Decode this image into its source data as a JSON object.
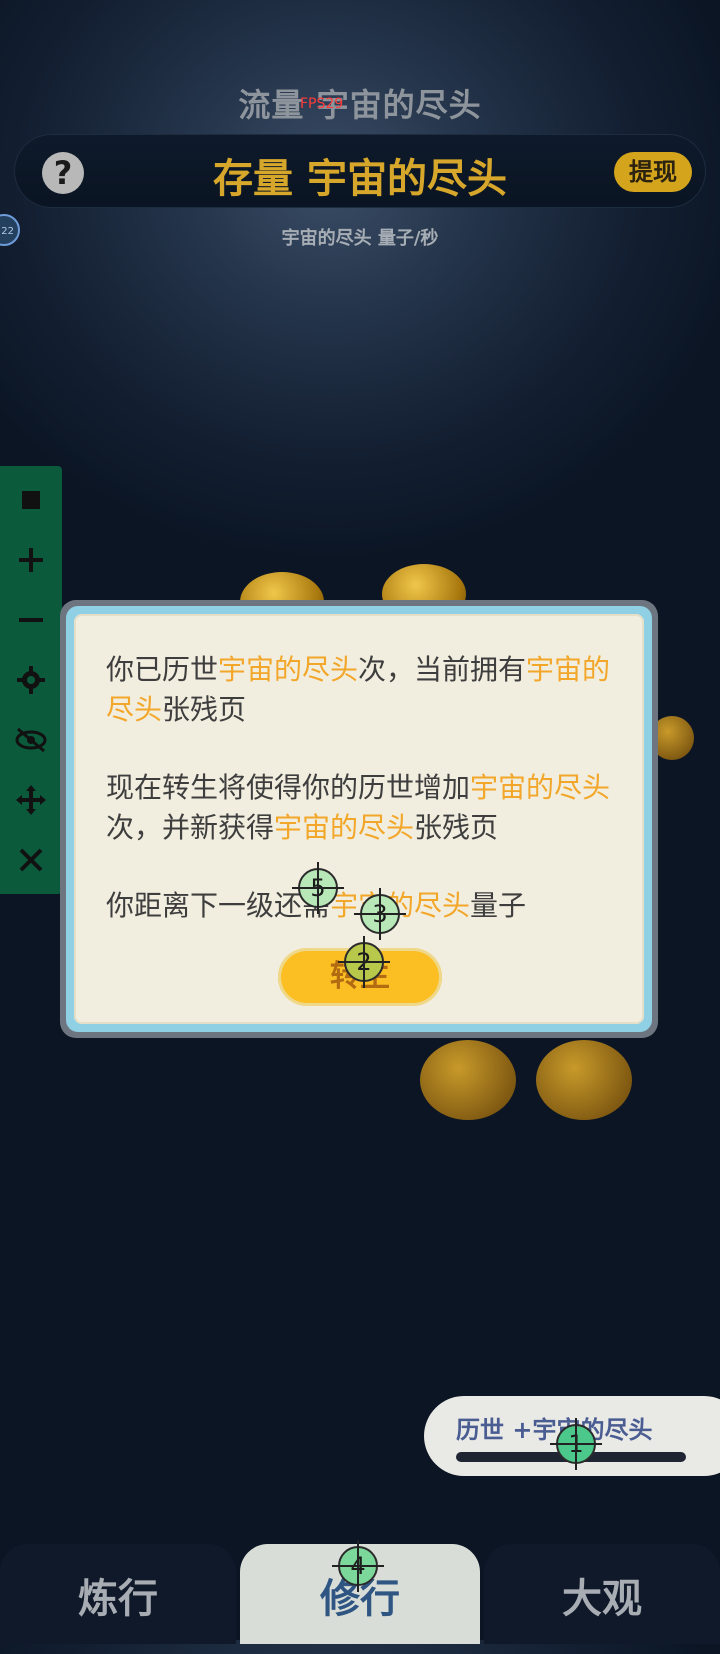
{
  "header": {
    "flow_title": "流量 宇宙的尽头",
    "fps": "FPS29",
    "stock_title": "存量 宇宙的尽头",
    "withdraw_label": "提现",
    "help_label": "?",
    "level_badge": "22",
    "rate_text": "宇宙的尽头  量子/秒"
  },
  "dialog": {
    "p1_a": "你已历世",
    "p1_b": "宇宙的尽头",
    "p1_c": "次，当前拥有",
    "p1_d": "宇宙的尽头",
    "p1_e": "张残页",
    "p2_a": "现在转生将使得你的历世增加",
    "p2_b": "宇宙的尽头",
    "p2_c": "次，并新获得",
    "p2_d": "宇宙的尽头",
    "p2_e": "张残页",
    "p3_a": "你距离下一级还需",
    "p3_b": "宇宙的尽头",
    "p3_c": "量子",
    "button_label": "转生"
  },
  "history": {
    "text": "历世 +宇宙的尽头"
  },
  "bottom_nav": {
    "tabs": [
      {
        "label": "炼行"
      },
      {
        "label": "修行"
      },
      {
        "label": "大观"
      }
    ],
    "active_index": 1
  },
  "toolbar": {
    "icons": [
      "stop-icon",
      "plus-icon",
      "minus-icon",
      "gear-icon",
      "eye-off-icon",
      "move-icon",
      "close-icon"
    ]
  },
  "markers": [
    "1",
    "2",
    "3",
    "4",
    "5"
  ],
  "colors": {
    "highlight": "#f2a72a",
    "gold": "#d6a72a",
    "toolbar_bg": "#0b5a3c",
    "button": "#fbbf24",
    "active_tab_text": "#2f5582"
  }
}
